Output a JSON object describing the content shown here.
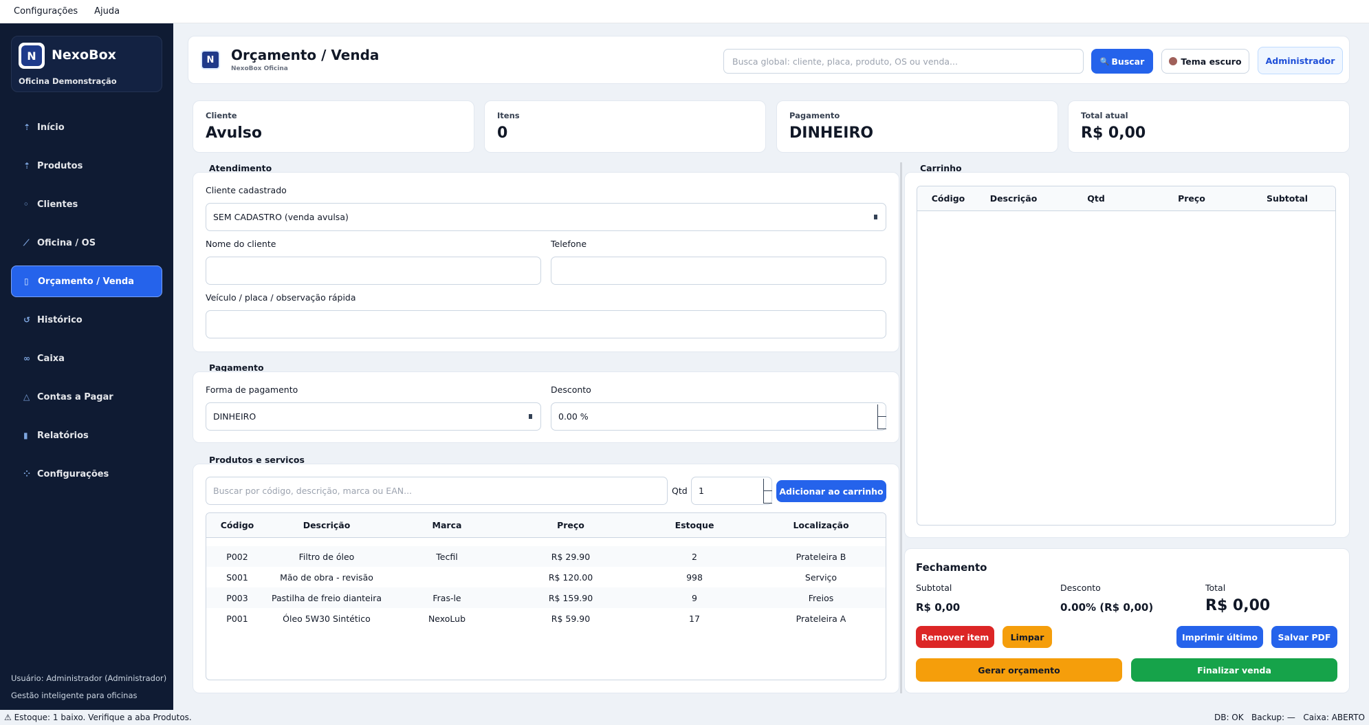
{
  "menubar": {
    "items": [
      "Configurações",
      "Ajuda"
    ]
  },
  "brand": {
    "logo": "N",
    "name": "NexoBox",
    "subtitle": "Oficina Demonstração"
  },
  "sidebar": {
    "items": [
      {
        "label": "Início",
        "icon": "home-icon",
        "glyph": "⇡"
      },
      {
        "label": "Produtos",
        "icon": "box-icon",
        "glyph": "⇡"
      },
      {
        "label": "Clientes",
        "icon": "user-icon",
        "glyph": "◦"
      },
      {
        "label": "Oficina / OS",
        "icon": "wrench-icon",
        "glyph": "⟋"
      },
      {
        "label": "Orçamento / Venda",
        "icon": "document-icon",
        "glyph": "▯"
      },
      {
        "label": "Histórico",
        "icon": "history-icon",
        "glyph": "↺"
      },
      {
        "label": "Caixa",
        "icon": "cash-icon",
        "glyph": "∞"
      },
      {
        "label": "Contas a Pagar",
        "icon": "warning-icon",
        "glyph": "△"
      },
      {
        "label": "Relatórios",
        "icon": "chart-icon",
        "glyph": "▮"
      },
      {
        "label": "Configurações",
        "icon": "gear-icon",
        "glyph": "⁘"
      }
    ],
    "active_index": 4,
    "footer_user": "Usuário: Administrador (Administrador)",
    "footer_tagline": "Gestão inteligente para oficinas"
  },
  "header": {
    "logo": "N",
    "title": "Orçamento / Venda",
    "subtitle": "NexoBox Oficina",
    "search_placeholder": "Busca global: cliente, placa, produto, OS ou venda...",
    "search_button": "Buscar",
    "search_button_glyph": "🔍",
    "theme_button": "Tema escuro",
    "admin_button": "Administrador"
  },
  "summary": {
    "cliente": {
      "label": "Cliente",
      "value": "Avulso"
    },
    "itens": {
      "label": "Itens",
      "value": "0"
    },
    "pagamento": {
      "label": "Pagamento",
      "value": "DINHEIRO"
    },
    "total": {
      "label": "Total atual",
      "value": "R$ 0,00"
    }
  },
  "atendimento": {
    "title": "Atendimento",
    "cliente_cadastrado_label": "Cliente cadastrado",
    "cliente_cadastrado_value": "SEM CADASTRO (venda avulsa)",
    "nome_label": "Nome do cliente",
    "nome_value": "",
    "telefone_label": "Telefone",
    "telefone_value": "",
    "veiculo_label": "Veículo / placa / observação rápida",
    "veiculo_value": ""
  },
  "pagamento": {
    "title": "Pagamento",
    "forma_label": "Forma de pagamento",
    "forma_value": "DINHEIRO",
    "desconto_label": "Desconto",
    "desconto_value": "0.00 %"
  },
  "produtos": {
    "title": "Produtos e serviços",
    "search_placeholder": "Buscar por código, descrição, marca ou EAN...",
    "qtd_label": "Qtd",
    "qtd_value": "1",
    "add_button": "Adicionar ao carrinho",
    "columns": [
      "Código",
      "Descrição",
      "Marca",
      "Preço",
      "Estoque",
      "Localização"
    ],
    "rows": [
      [
        "P002",
        "Filtro de óleo",
        "Tecfil",
        "R$ 29.90",
        "2",
        "Prateleira B"
      ],
      [
        "S001",
        "Mão de obra - revisão",
        "",
        "R$ 120.00",
        "998",
        "Serviço"
      ],
      [
        "P003",
        "Pastilha de freio dianteira",
        "Fras-le",
        "R$ 159.90",
        "9",
        "Freios"
      ],
      [
        "P001",
        "Óleo 5W30 Sintético",
        "NexoLub",
        "R$ 59.90",
        "17",
        "Prateleira A"
      ]
    ]
  },
  "carrinho": {
    "title": "Carrinho",
    "columns": [
      "Código",
      "Descrição",
      "Qtd",
      "Preço",
      "Subtotal"
    ]
  },
  "fechamento": {
    "title": "Fechamento",
    "subtotal_label": "Subtotal",
    "subtotal_value": "R$ 0,00",
    "desconto_label": "Desconto",
    "desconto_value": "0.00% (R$ 0,00)",
    "total_label": "Total",
    "total_value": "R$ 0,00",
    "remover_button": "Remover item",
    "limpar_button": "Limpar",
    "imprimir_button": "Imprimir último",
    "salvar_pdf_button": "Salvar PDF",
    "gerar_orcamento_button": "Gerar orçamento",
    "finalizar_button": "Finalizar venda"
  },
  "statusbar": {
    "left": "⚠ Estoque: 1 baixo. Verifique a aba Produtos.",
    "right": "DB: OK   Backup: —   Caixa: ABERTO"
  },
  "colors": {
    "sidebar_bg": "#0f1b33",
    "accent_blue": "#2563eb",
    "danger_red": "#dc2626",
    "warning_orange": "#f59e0b",
    "success_green": "#16a34a"
  }
}
